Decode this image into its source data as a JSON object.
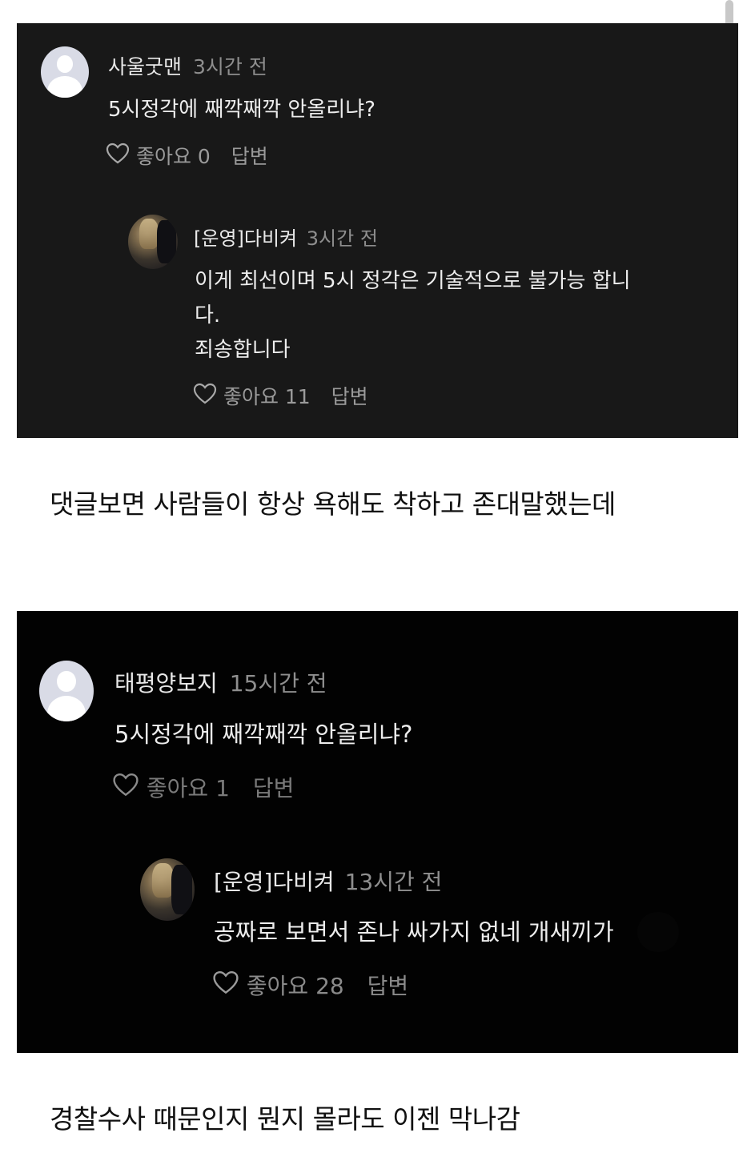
{
  "screenshot1": {
    "comment": {
      "author": "사울굿맨",
      "time": "3시간 전",
      "text": "5시정각에 째깍째깍 안올리냐?",
      "like_label": "좋아요 0",
      "reply_label": "답변"
    },
    "reply": {
      "author": "[운영]다비켜",
      "time": "3시간 전",
      "text_line1": "이게 최선이며 5시 정각은 기술적으로 불가능 합니",
      "text_line2": "다.",
      "text_line3": "죄송합니다",
      "like_label": "좋아요 11",
      "reply_label": "답변"
    }
  },
  "caption1": "댓글보면 사람들이 항상 욕해도 착하고 존대말했는데",
  "screenshot2": {
    "comment": {
      "author": "태평양보지",
      "time": "15시간 전",
      "text": "5시정각에 째깍째깍 안올리냐?",
      "like_label": "좋아요 1",
      "reply_label": "답변"
    },
    "reply": {
      "author": "[운영]다비켜",
      "time": "13시간 전",
      "text": "공짜로 보면서 존나 싸가지 없네 개새끼가",
      "like_label": "좋아요 28",
      "reply_label": "답변"
    }
  },
  "caption2": "경찰수사 때문인지 뭔지 몰라도 이젠 막나감",
  "icons": {
    "default_avatar": "default-user-avatar",
    "profile_photo": "user-photo-avatar",
    "like": "heart-icon"
  },
  "colors": {
    "panel_bg": "#181818",
    "panel_bg_dark": "#020202",
    "text_primary": "#ededed",
    "text_secondary": "#8e8e8e"
  }
}
